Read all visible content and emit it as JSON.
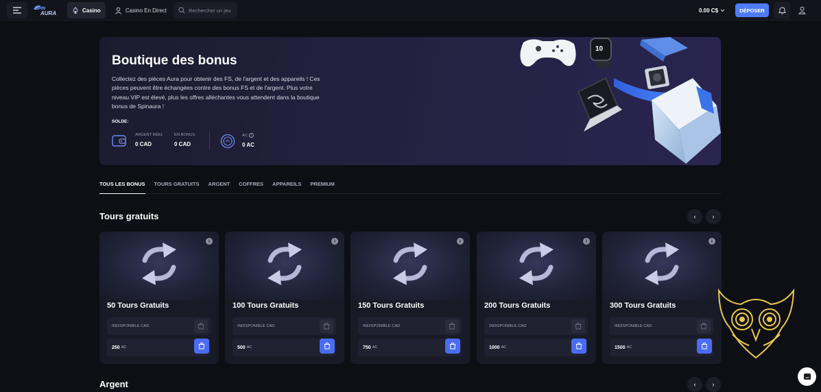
{
  "topbar": {
    "logo_text": "SPIN AURA",
    "casino_label": "Casino",
    "live_label": "Casino En Direct",
    "search_placeholder": "Rechercher un jeu",
    "balance": "0.00 C$",
    "deposit_label": "DÉPOSER"
  },
  "hero": {
    "title": "Boutique des bonus",
    "description": "Collectez des pièces Aura pour obtenir des FS, de l'argent et des appareils ! Ces pièces peuvent être échangées contre des bonus FS et de l'argent. Plus votre niveau VIP est élevé, plus les offres alléchantes vous attendent dans la boutique bonus de Spinaura !",
    "solde_label": "SOLDE:",
    "real_money_label": "ARGENT RÉEL",
    "real_money_value": "0 CAD",
    "bonus_label": "EN BONUS",
    "bonus_value": "0 CAD",
    "ac_label": "AC",
    "ac_value": "0 AC"
  },
  "tabs": [
    "TOUS LES BONUS",
    "TOURS GRATUITS",
    "ARGENT",
    "COFFRES",
    "APPAREILS",
    "PREMIUM"
  ],
  "sections": {
    "free_spins_title": "Tours gratuits",
    "money_title": "Argent"
  },
  "cards": [
    {
      "title": "50 Tours Gratuits",
      "status": "INDISPONIBLE CAD",
      "price": "250",
      "unit": "AC"
    },
    {
      "title": "100 Tours Gratuits",
      "status": "INDISPONIBLE CAD",
      "price": "500",
      "unit": "AC"
    },
    {
      "title": "150 Tours Gratuits",
      "status": "INDISPONIBLE CAD",
      "price": "750",
      "unit": "AC"
    },
    {
      "title": "200 Tours Gratuits",
      "status": "INDISPONIBLE CAD",
      "price": "1000",
      "unit": "AC"
    },
    {
      "title": "300 Tours Gratuits",
      "status": "INDISPONIBLE CAD",
      "price": "1500",
      "unit": "AC"
    }
  ],
  "colors": {
    "accent": "#4f7bf7",
    "background": "#0e0f15",
    "card": "#181a26",
    "owl_gold": "#e8c84a"
  }
}
